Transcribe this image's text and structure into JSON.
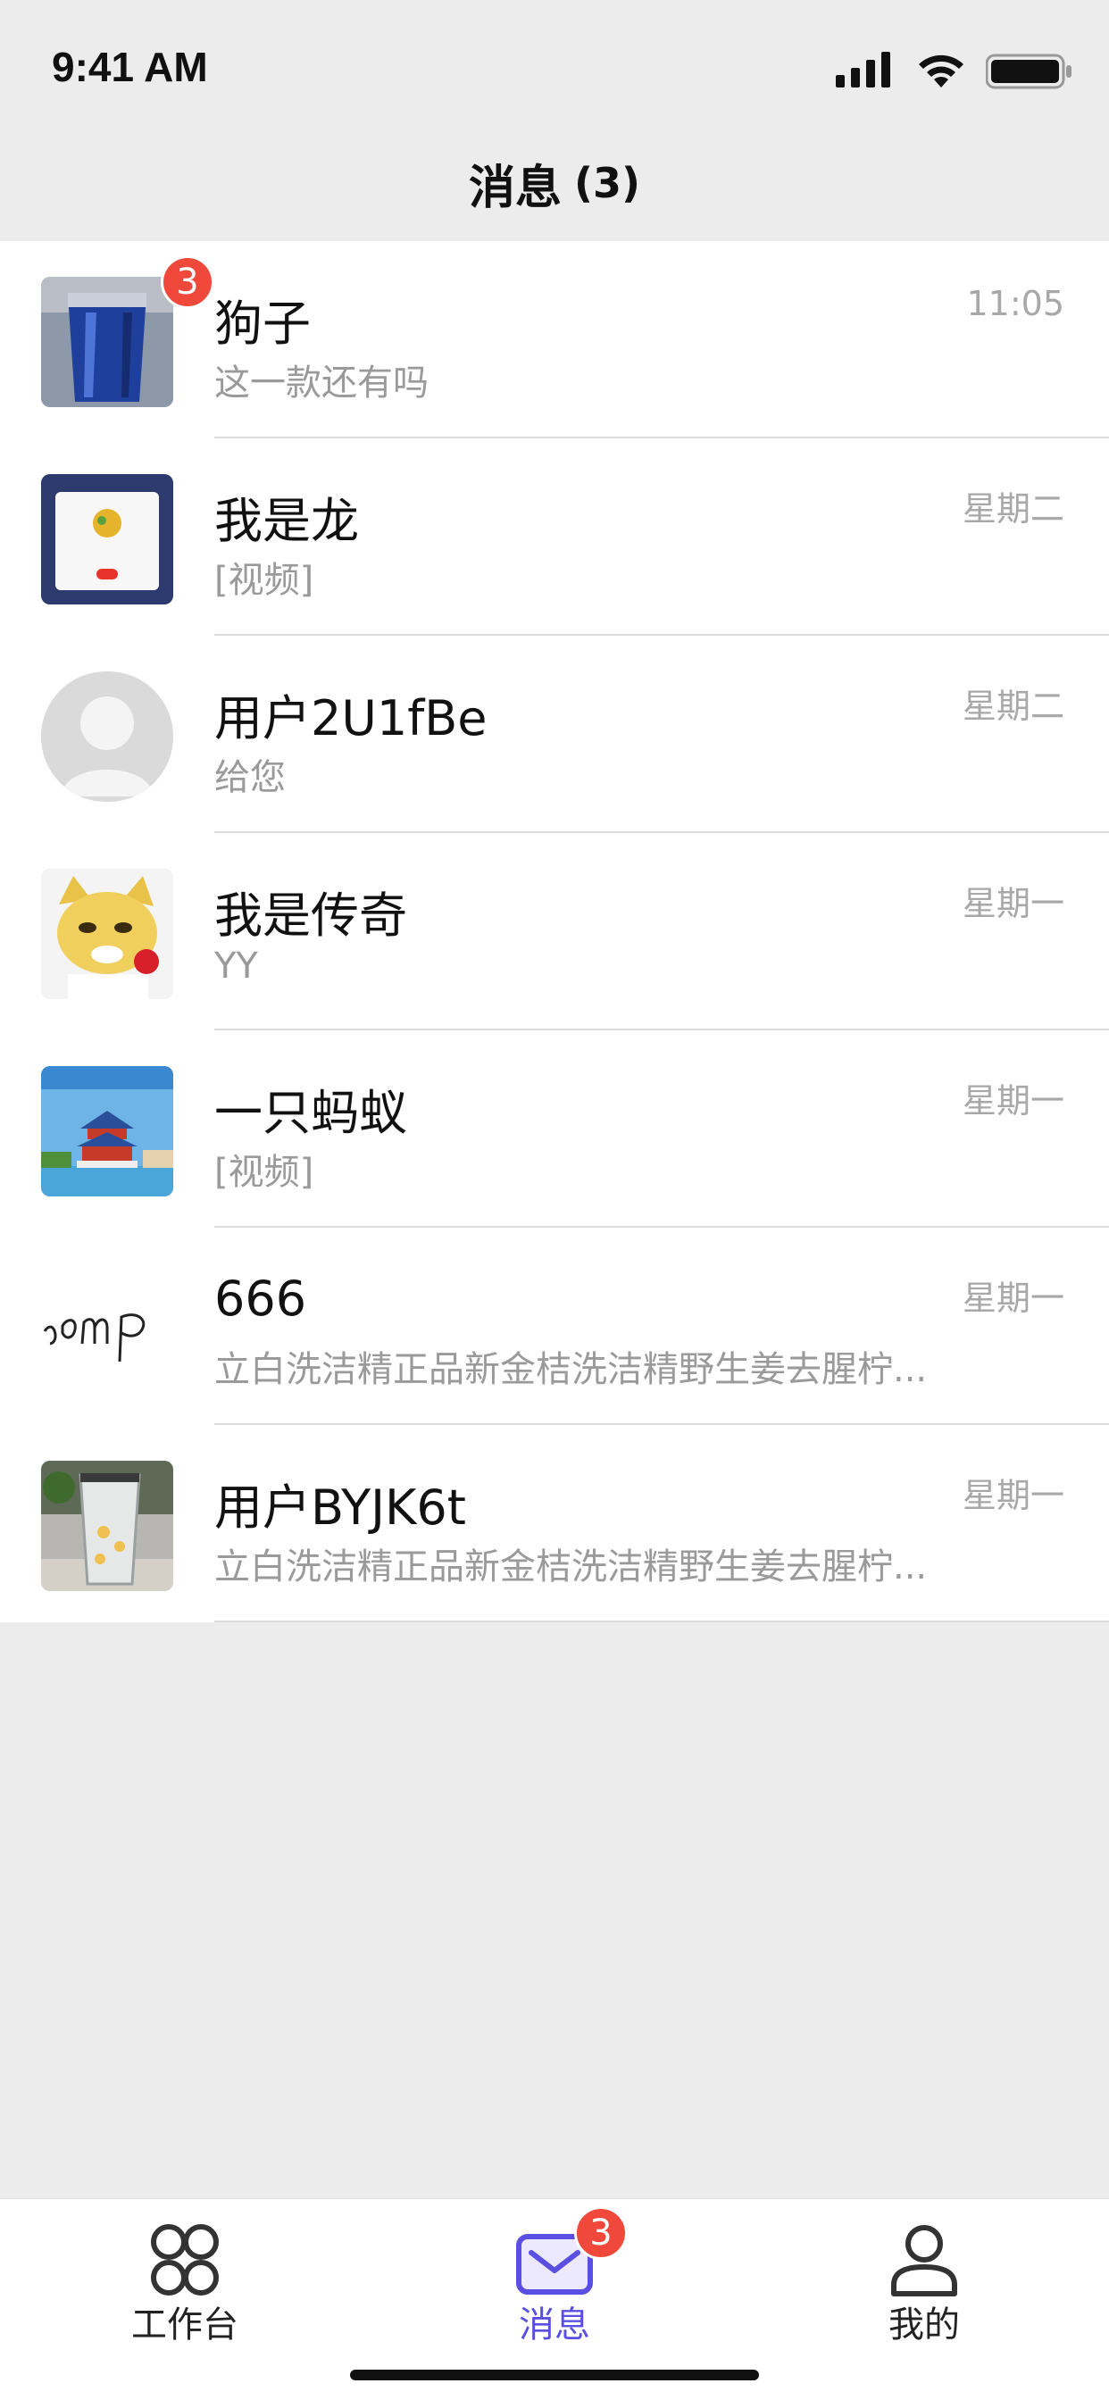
{
  "status_bar": {
    "time": "9:41 AM",
    "icons": [
      "signal-icon",
      "wifi-icon",
      "battery-icon"
    ]
  },
  "header": {
    "title": "消息",
    "count": "(3)"
  },
  "conversations": [
    {
      "name": "狗子",
      "preview": "这一款还有吗",
      "time": "11:05",
      "badge": "3",
      "avatar": "blue-cup-photo"
    },
    {
      "name": "我是龙",
      "preview": "[视频]",
      "time": "星期二",
      "badge": "",
      "avatar": "app-screenshot-photo"
    },
    {
      "name": "用户2U1fBe",
      "preview": "给您",
      "time": "星期二",
      "badge": "",
      "avatar": "default-user-icon"
    },
    {
      "name": "我是传奇",
      "preview": "YY",
      "time": "星期一",
      "badge": "",
      "avatar": "dog-meme-photo"
    },
    {
      "name": "一只蚂蚁",
      "preview": "[视频]",
      "time": "星期一",
      "badge": "",
      "avatar": "temple-landscape-photo"
    },
    {
      "name": "666",
      "preview": "立白洗洁精正品新金桔洗洁精野生姜去腥柠...",
      "time": "星期一",
      "badge": "",
      "avatar": "handwriting-photo"
    },
    {
      "name": "用户BYJK6t",
      "preview": "立白洗洁精正品新金桔洗洁精野生姜去腥柠...",
      "time": "星期一",
      "badge": "",
      "avatar": "glass-cup-photo"
    }
  ],
  "tab_bar": {
    "tabs": [
      {
        "label": "工作台",
        "icon": "grid-icon",
        "active": false
      },
      {
        "label": "消息",
        "icon": "mail-icon",
        "active": true,
        "badge": "3"
      },
      {
        "label": "我的",
        "icon": "user-icon",
        "active": false
      }
    ]
  },
  "colors": {
    "accent": "#5a4fe0",
    "badge": "#f0493c",
    "background": "#ececec"
  }
}
